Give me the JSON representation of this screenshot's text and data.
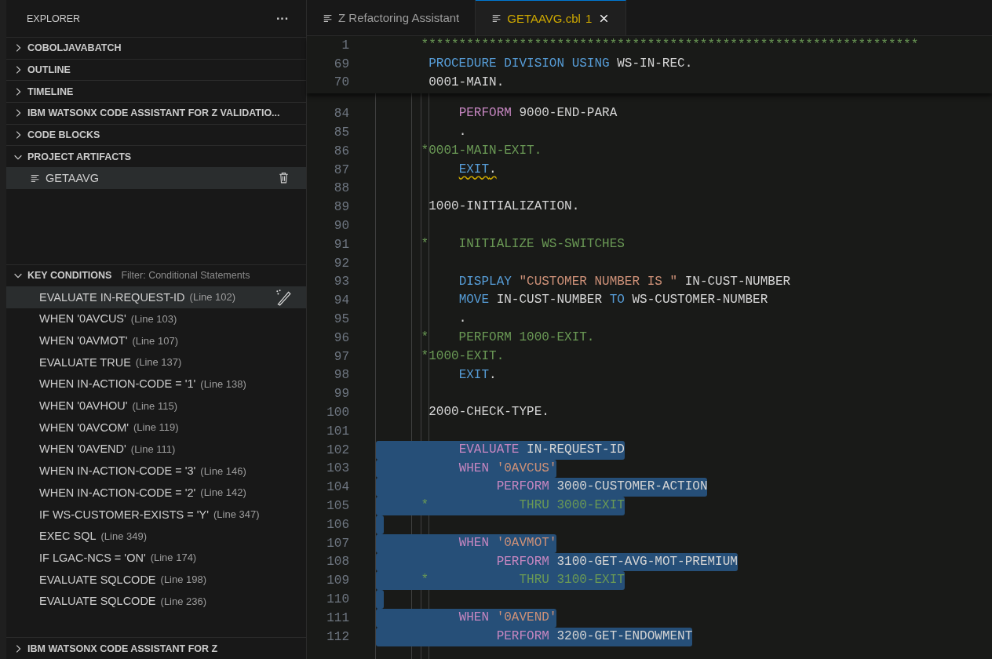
{
  "sidebar": {
    "title": "EXPLORER",
    "more": "···",
    "sections": [
      {
        "title": "COBOLJAVABATCH",
        "expanded": false
      },
      {
        "title": "OUTLINE",
        "expanded": false
      },
      {
        "title": "TIMELINE",
        "expanded": false
      },
      {
        "title": "IBM WATSONX CODE ASSISTANT FOR Z VALIDATIO...",
        "expanded": false
      },
      {
        "title": "CODE BLOCKS",
        "expanded": false
      },
      {
        "title": "PROJECT ARTIFACTS",
        "expanded": true,
        "kind": "files",
        "items": [
          {
            "label": "GETAAVG",
            "selected": true
          }
        ]
      },
      {
        "title": "KEY CONDITIONS",
        "expanded": true,
        "kind": "conditions",
        "filter": "Filter: Conditional Statements",
        "items": [
          {
            "label": "EVALUATE IN-REQUEST-ID",
            "line": "(Line 102)",
            "selected": true
          },
          {
            "label": "WHEN '0AVCUS'",
            "line": "(Line 103)",
            "selected": false
          },
          {
            "label": "WHEN '0AVMOT'",
            "line": "(Line 107)",
            "selected": false
          },
          {
            "label": "EVALUATE TRUE",
            "line": "(Line 137)",
            "selected": false
          },
          {
            "label": "WHEN IN-ACTION-CODE = '1'",
            "line": "(Line 138)",
            "selected": false
          },
          {
            "label": "WHEN '0AVHOU'",
            "line": "(Line 115)",
            "selected": false
          },
          {
            "label": "WHEN '0AVCOM'",
            "line": "(Line 119)",
            "selected": false
          },
          {
            "label": "WHEN '0AVEND'",
            "line": "(Line 111)",
            "selected": false
          },
          {
            "label": "WHEN IN-ACTION-CODE = '3'",
            "line": "(Line 146)",
            "selected": false
          },
          {
            "label": "WHEN IN-ACTION-CODE = '2'",
            "line": "(Line 142)",
            "selected": false
          },
          {
            "label": "IF WS-CUSTOMER-EXISTS = 'Y'",
            "line": "(Line 347)",
            "selected": false
          },
          {
            "label": "EXEC SQL",
            "line": "(Line 349)",
            "selected": false
          },
          {
            "label": "IF LGAC-NCS = 'ON'",
            "line": "(Line 174)",
            "selected": false
          },
          {
            "label": "EVALUATE SQLCODE",
            "line": "(Line 198)",
            "selected": false
          },
          {
            "label": "EVALUATE SQLCODE",
            "line": "(Line 236)",
            "selected": false
          }
        ]
      },
      {
        "title": "IBM WATSONX CODE ASSISTANT FOR Z",
        "expanded": false
      }
    ]
  },
  "tabs": [
    {
      "label": "Z Refactoring Assistant",
      "selected": false
    },
    {
      "label": "GETAAVG.cbl",
      "problems": "1",
      "selected": true
    }
  ],
  "editor": {
    "sticky_lines": [
      {
        "number": "1",
        "tokens": [
          {
            "kind": "comment",
            "text": "      ******************************************************************"
          }
        ]
      },
      {
        "number": "69",
        "tokens": [
          {
            "kind": "keyword",
            "text": "       PROCEDURE DIVISION USING"
          },
          {
            "kind": "plain",
            "text": " WS-IN-REC."
          }
        ]
      },
      {
        "number": "70",
        "tokens": [
          {
            "kind": "plain",
            "text": "       0001-MAIN."
          }
        ]
      }
    ],
    "lines": [
      {
        "number": "84",
        "selected": false,
        "tokens": [
          {
            "kind": "control",
            "text": "           PERFORM"
          },
          {
            "kind": "plain",
            "text": " 9000-END-PARA"
          }
        ]
      },
      {
        "number": "85",
        "selected": false,
        "tokens": [
          {
            "kind": "plain",
            "text": "           ."
          }
        ]
      },
      {
        "number": "86",
        "selected": false,
        "tokens": [
          {
            "kind": "comment",
            "text": "      *0001-MAIN-EXIT."
          }
        ]
      },
      {
        "number": "87",
        "selected": false,
        "tokens": [
          {
            "kind": "keyword",
            "text": "           EXIT",
            "warning": true
          },
          {
            "kind": "plain",
            "text": ".",
            "warning": true
          }
        ]
      },
      {
        "number": "88",
        "selected": false
      },
      {
        "number": "89",
        "selected": false,
        "tokens": [
          {
            "kind": "plain",
            "text": "       1000-INITIALIZATION."
          }
        ]
      },
      {
        "number": "90",
        "selected": false
      },
      {
        "number": "91",
        "selected": false,
        "tokens": [
          {
            "kind": "comment",
            "text": "      *    INITIALIZE WS-SWITCHES"
          }
        ]
      },
      {
        "number": "92",
        "selected": false
      },
      {
        "number": "93",
        "selected": false,
        "tokens": [
          {
            "kind": "keyword",
            "text": "           DISPLAY "
          },
          {
            "kind": "string",
            "text": "\"CUSTOMER NUMBER IS \""
          },
          {
            "kind": "plain",
            "text": " IN-CUST-NUMBER"
          }
        ]
      },
      {
        "number": "94",
        "selected": false,
        "tokens": [
          {
            "kind": "keyword",
            "text": "           MOVE"
          },
          {
            "kind": "plain",
            "text": " IN-CUST-NUMBER "
          },
          {
            "kind": "keyword",
            "text": "TO"
          },
          {
            "kind": "plain",
            "text": " WS-CUSTOMER-NUMBER"
          }
        ]
      },
      {
        "number": "95",
        "selected": false,
        "tokens": [
          {
            "kind": "plain",
            "text": "           ."
          }
        ]
      },
      {
        "number": "96",
        "selected": false,
        "tokens": [
          {
            "kind": "comment",
            "text": "      *    PERFORM 1000-EXIT."
          }
        ]
      },
      {
        "number": "97",
        "selected": false,
        "tokens": [
          {
            "kind": "comment",
            "text": "      *1000-EXIT."
          }
        ]
      },
      {
        "number": "98",
        "selected": false,
        "tokens": [
          {
            "kind": "keyword",
            "text": "           EXIT"
          },
          {
            "kind": "plain",
            "text": "."
          }
        ]
      },
      {
        "number": "99",
        "selected": false
      },
      {
        "number": "100",
        "selected": false,
        "tokens": [
          {
            "kind": "plain",
            "text": "       2000-CHECK-TYPE."
          }
        ]
      },
      {
        "number": "101",
        "selected": false
      },
      {
        "number": "102",
        "selected": true,
        "tokens": [
          {
            "kind": "control",
            "text": "           EVALUATE"
          },
          {
            "kind": "plain",
            "text": " IN-REQUEST-ID"
          }
        ]
      },
      {
        "number": "103",
        "selected": true,
        "tokens": [
          {
            "kind": "control",
            "text": "           WHEN"
          },
          {
            "kind": "string",
            "text": " '0AVCUS'"
          }
        ]
      },
      {
        "number": "104",
        "selected": true,
        "tokens": [
          {
            "kind": "control",
            "text": "                PERFORM"
          },
          {
            "kind": "plain",
            "text": " 3000-CUSTOMER-ACTION"
          }
        ]
      },
      {
        "number": "105",
        "selected": true,
        "tokens": [
          {
            "kind": "comment",
            "text": "      *            THRU 3000-EXIT"
          }
        ]
      },
      {
        "number": "106",
        "selected": true
      },
      {
        "number": "107",
        "selected": true,
        "tokens": [
          {
            "kind": "control",
            "text": "           WHEN"
          },
          {
            "kind": "string",
            "text": " '0AVMOT'"
          }
        ]
      },
      {
        "number": "108",
        "selected": true,
        "tokens": [
          {
            "kind": "control",
            "text": "                PERFORM"
          },
          {
            "kind": "plain",
            "text": " 3100-GET-AVG-MOT-PREMIUM"
          }
        ]
      },
      {
        "number": "109",
        "selected": true,
        "tokens": [
          {
            "kind": "comment",
            "text": "      *            THRU 3100-EXIT"
          }
        ]
      },
      {
        "number": "110",
        "selected": true
      },
      {
        "number": "111",
        "selected": true,
        "tokens": [
          {
            "kind": "control",
            "text": "           WHEN"
          },
          {
            "kind": "string",
            "text": " '0AVEND'"
          }
        ]
      },
      {
        "number": "112",
        "selected": true,
        "tokens": [
          {
            "kind": "control",
            "text": "                PERFORM"
          },
          {
            "kind": "plain",
            "text": " 3200-GET-ENDOWMENT"
          }
        ]
      }
    ]
  }
}
